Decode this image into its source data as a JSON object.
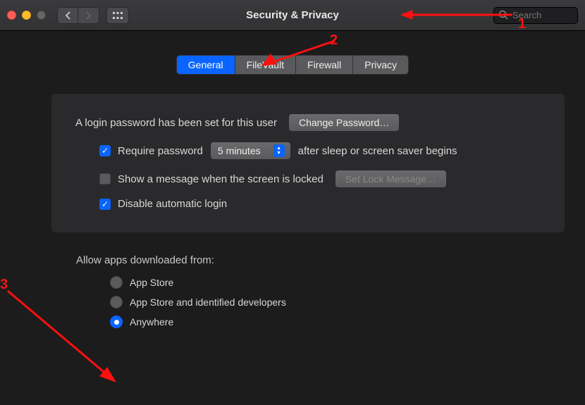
{
  "window": {
    "title": "Security & Privacy"
  },
  "search": {
    "placeholder": "Search"
  },
  "tabs": [
    {
      "label": "General",
      "active": true
    },
    {
      "label": "FileVault",
      "active": false
    },
    {
      "label": "Firewall",
      "active": false
    },
    {
      "label": "Privacy",
      "active": false
    }
  ],
  "login": {
    "desc": "A login password has been set for this user",
    "change_btn": "Change Password…",
    "require_label": "Require password",
    "require_after_label": "after sleep or screen saver begins",
    "require_checked": true,
    "delay_value": "5 minutes",
    "show_msg_label": "Show a message when the screen is locked",
    "show_msg_checked": false,
    "set_lock_btn": "Set Lock Message…",
    "disable_auto_label": "Disable automatic login",
    "disable_auto_checked": true
  },
  "download": {
    "section_label": "Allow apps downloaded from:",
    "options": [
      {
        "label": "App Store",
        "selected": false
      },
      {
        "label": "App Store and identified developers",
        "selected": false
      },
      {
        "label": "Anywhere",
        "selected": true
      }
    ]
  },
  "annotations": {
    "a1": "1",
    "a2": "2",
    "a3": "3"
  }
}
